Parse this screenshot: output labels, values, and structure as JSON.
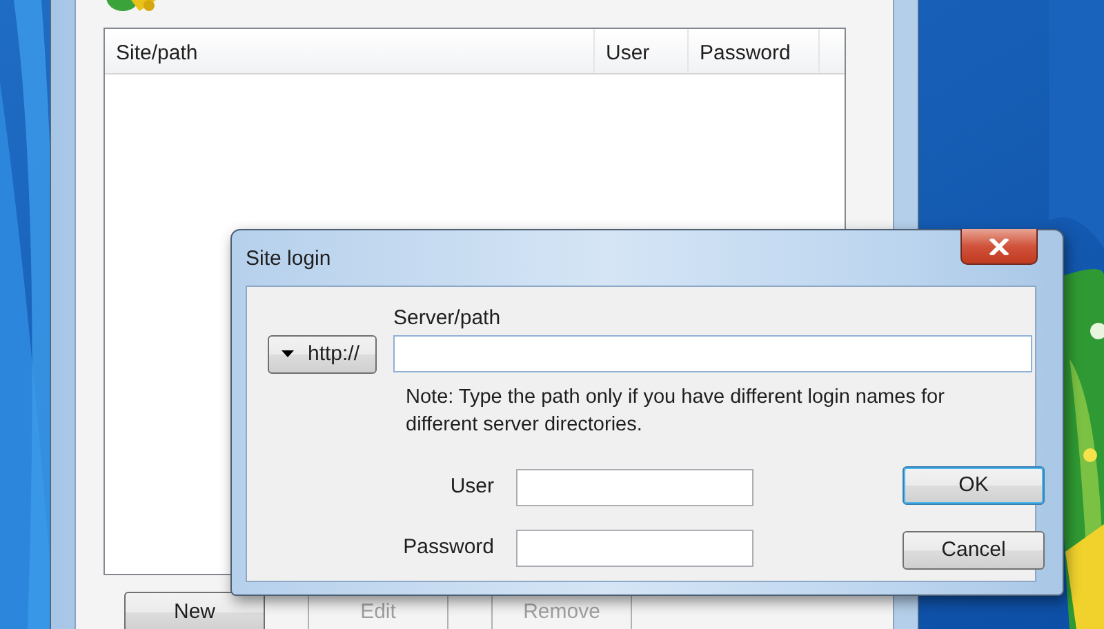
{
  "background_window": {
    "columns": [
      "Site/path",
      "User",
      "Password"
    ],
    "buttons": [
      {
        "label": "New",
        "disabled": false
      },
      {
        "label": "Edit",
        "disabled": true
      },
      {
        "label": "Remove",
        "disabled": true
      }
    ]
  },
  "dialog": {
    "title": "Site login",
    "protocol_button": {
      "label": "http://"
    },
    "server_label": "Server/path",
    "note": "Note: Type the path only if you have different login names for different server directories.",
    "fields": [
      {
        "label": "User"
      },
      {
        "label": "Password"
      }
    ],
    "buttons": [
      {
        "label": "OK",
        "default": true
      },
      {
        "label": "Cancel",
        "default": false
      }
    ]
  }
}
